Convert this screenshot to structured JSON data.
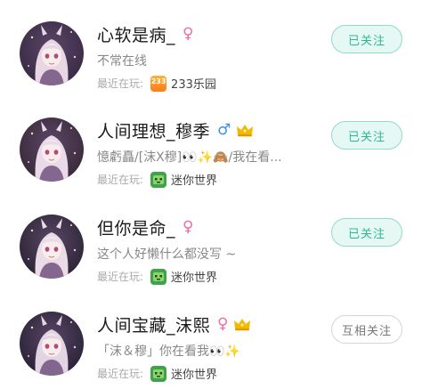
{
  "users": [
    {
      "name": "心软是病_",
      "gender": "female",
      "gender_symbol": "♀",
      "crown": false,
      "signature": "不常在线",
      "recent_label": "最近在玩:",
      "game_icon": "233-app-icon",
      "game_icon_text": "233",
      "game_name": "233乐园",
      "button_label": "已关注",
      "button_state": "followed"
    },
    {
      "name": "人间理想_穆季",
      "gender": "male",
      "gender_symbol": "♂",
      "crown": true,
      "signature": "憶虧矗/[沫X穆]👀✨🙈/我在看...",
      "recent_label": "最近在玩:",
      "game_icon": "mini-world-icon",
      "game_name": "迷你世界",
      "button_label": "已关注",
      "button_state": "followed"
    },
    {
      "name": "但你是命_",
      "gender": "female",
      "gender_symbol": "♀",
      "crown": false,
      "signature": "这个人好懒什么都没写 ~",
      "recent_label": "最近在玩:",
      "game_icon": "mini-world-icon",
      "game_name": "迷你世界",
      "button_label": "已关注",
      "button_state": "followed"
    },
    {
      "name": "人间宝藏_沫熙",
      "gender": "female",
      "gender_symbol": "♀",
      "crown": true,
      "signature": "「沫＆穆」你在看我👀✨",
      "recent_label": "最近在玩:",
      "game_icon": "mini-world-icon",
      "game_name": "迷你世界",
      "button_label": "互相关注",
      "button_state": "mutual"
    }
  ],
  "colors": {
    "followed_text": "#2db893",
    "followed_bg": "#e6f8f3",
    "female": "#f06aa5",
    "male": "#3a8ff0",
    "crown": "#f5b800"
  }
}
